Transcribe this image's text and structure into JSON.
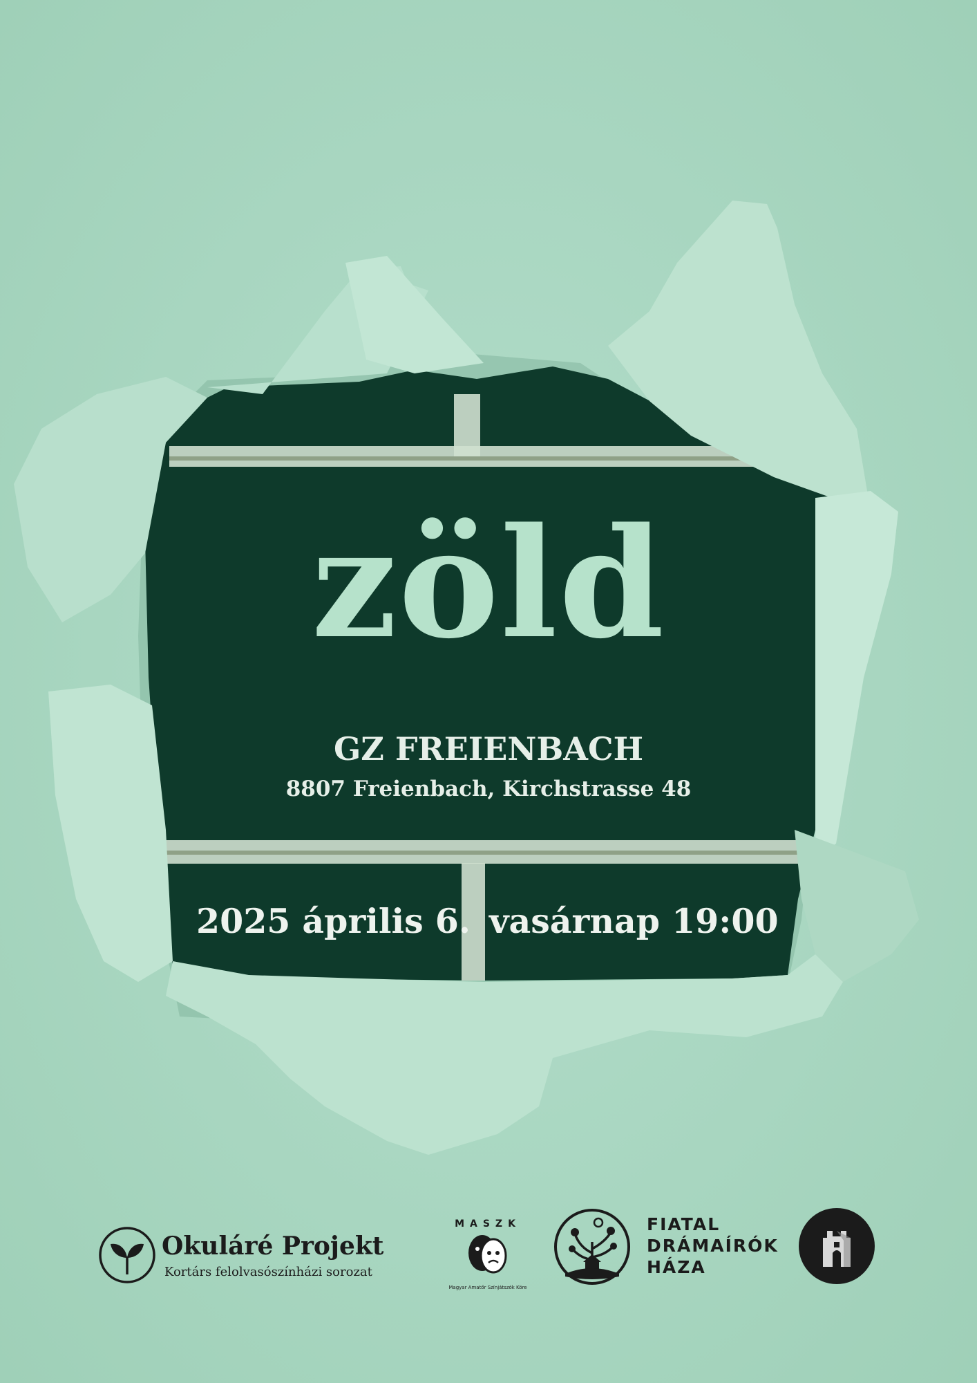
{
  "poster": {
    "title": "zöld",
    "venue_name": "GZ FREIENBACH",
    "venue_address": "8807 Freienbach, Kirchstrasse 48",
    "date": "2025 április 6.",
    "day_time": "vasárnap 19:00"
  },
  "logos": {
    "okulare": {
      "name": "Okuláré Projekt",
      "subtitle": "Kortárs felolvasószínházi sorozat",
      "icon": "seedling-icon"
    },
    "maszk": {
      "top_text": "MASZK",
      "bottom_text": "Magyar Amatőr Színjátszók Köre",
      "icon": "theatre-masks-icon"
    },
    "fiatal_dramairok": {
      "name_lines": "FIATAL\nDRÁMAÍRÓK\nHÁZA",
      "icon": "tree-house-emblem-icon"
    },
    "tower": {
      "icon": "tower-icon"
    }
  },
  "colors": {
    "paper": "#a9d6c0",
    "hole": "#0e3a2b",
    "title": "#b6e2cb",
    "text": "#e6efe8",
    "logo_ink": "#1b1b1b"
  }
}
